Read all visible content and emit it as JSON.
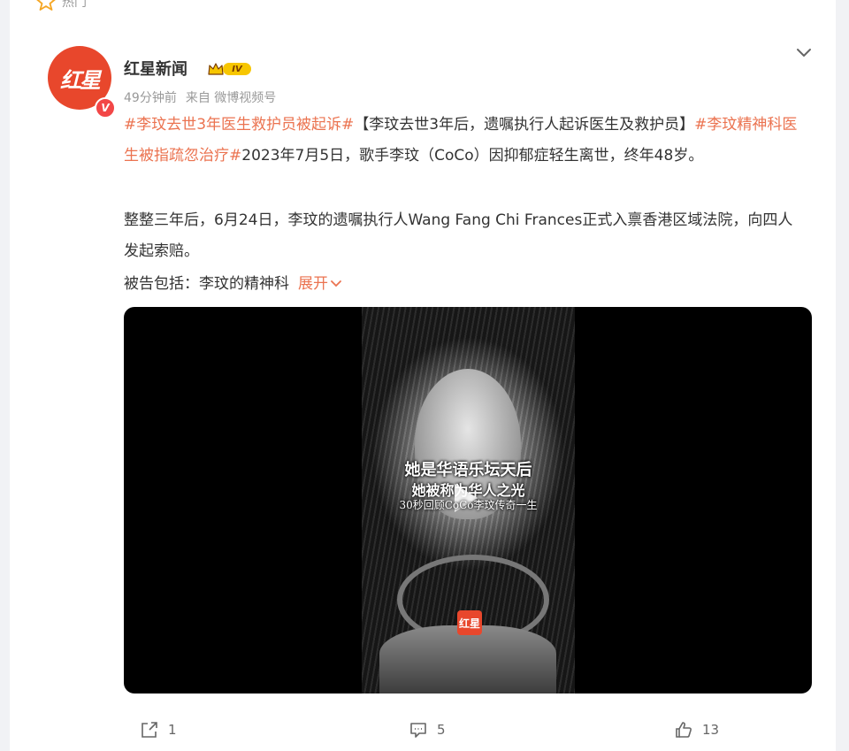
{
  "hot_label": "热门",
  "author": {
    "name": "红星新闻",
    "avatar_text": "红星",
    "verified_mark": "V",
    "level": "IV"
  },
  "meta": {
    "time": "49分钟前",
    "source": "来自 微博视频号"
  },
  "post": {
    "tag1": "#李玟去世3年医生救护员被起诉#",
    "headline": "【李玟去世3年后，遗嘱执行人起诉医生及救护员】",
    "tag2": "#李玟精神科医生被指疏忽治疗#",
    "body1": "2023年7月5日，歌手李玟（CoCo）因抑郁症轻生离世，终年48岁。",
    "body2": "整整三年后，6月24日，李玟的遗嘱执行人Wang Fang Chi Frances正式入禀香港区域法院，向四人发起索赔。",
    "body3": "被告包括：李玟的精神科",
    "expand_label": "展开"
  },
  "video": {
    "caption_line1": "她是华语乐坛天后",
    "caption_line2": "她被称为华人之光",
    "caption_line3": "30秒回顾CoCo李玟传奇一生",
    "watermark": "红星"
  },
  "actions": {
    "share_count": "1",
    "comment_count": "5",
    "like_count": "13"
  },
  "colors": {
    "accent": "#eb7350",
    "avatar_bg": "#e8472c"
  }
}
